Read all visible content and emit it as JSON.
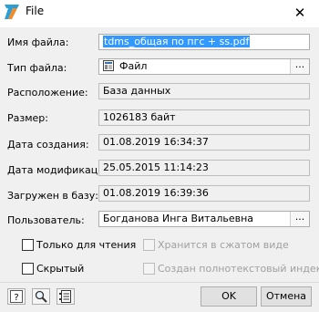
{
  "window": {
    "title": "File"
  },
  "fields": {
    "name": {
      "label": "Имя файла:",
      "value": "tdms_общая по пгс + ss.pdf"
    },
    "type": {
      "label": "Тип файла:",
      "value": "Файл",
      "button": "..."
    },
    "location": {
      "label": "Расположение:",
      "value": "База данных"
    },
    "size": {
      "label": "Размер:",
      "value": "1026183 байт"
    },
    "created": {
      "label": "Дата создания:",
      "value": "01.08.2019 16:34:37"
    },
    "modified": {
      "label": "Дата модификации:",
      "value": "25.05.2015 11:14:23"
    },
    "uploaded": {
      "label": "Загружен в базу:",
      "value": "01.08.2019 16:39:36"
    },
    "user": {
      "label": "Пользователь:",
      "value": "Богданова Инга Витальевна",
      "button": "..."
    }
  },
  "checkboxes": {
    "readonly": {
      "label": "Только для чтения",
      "checked": false,
      "enabled": true
    },
    "compressed": {
      "label": "Хранится в сжатом виде",
      "checked": false,
      "enabled": false
    },
    "hidden": {
      "label": "Скрытый",
      "checked": false,
      "enabled": true
    },
    "fulltext": {
      "label": "Создан полнотекстовый индекс",
      "checked": false,
      "enabled": false
    }
  },
  "buttons": {
    "ok": "OK",
    "cancel": "Отмена"
  },
  "icons": {
    "app": "tdms-logo-icon",
    "help": "help-icon",
    "search": "magnifier-icon",
    "properties": "properties-list-icon",
    "file": "file-type-icon"
  }
}
